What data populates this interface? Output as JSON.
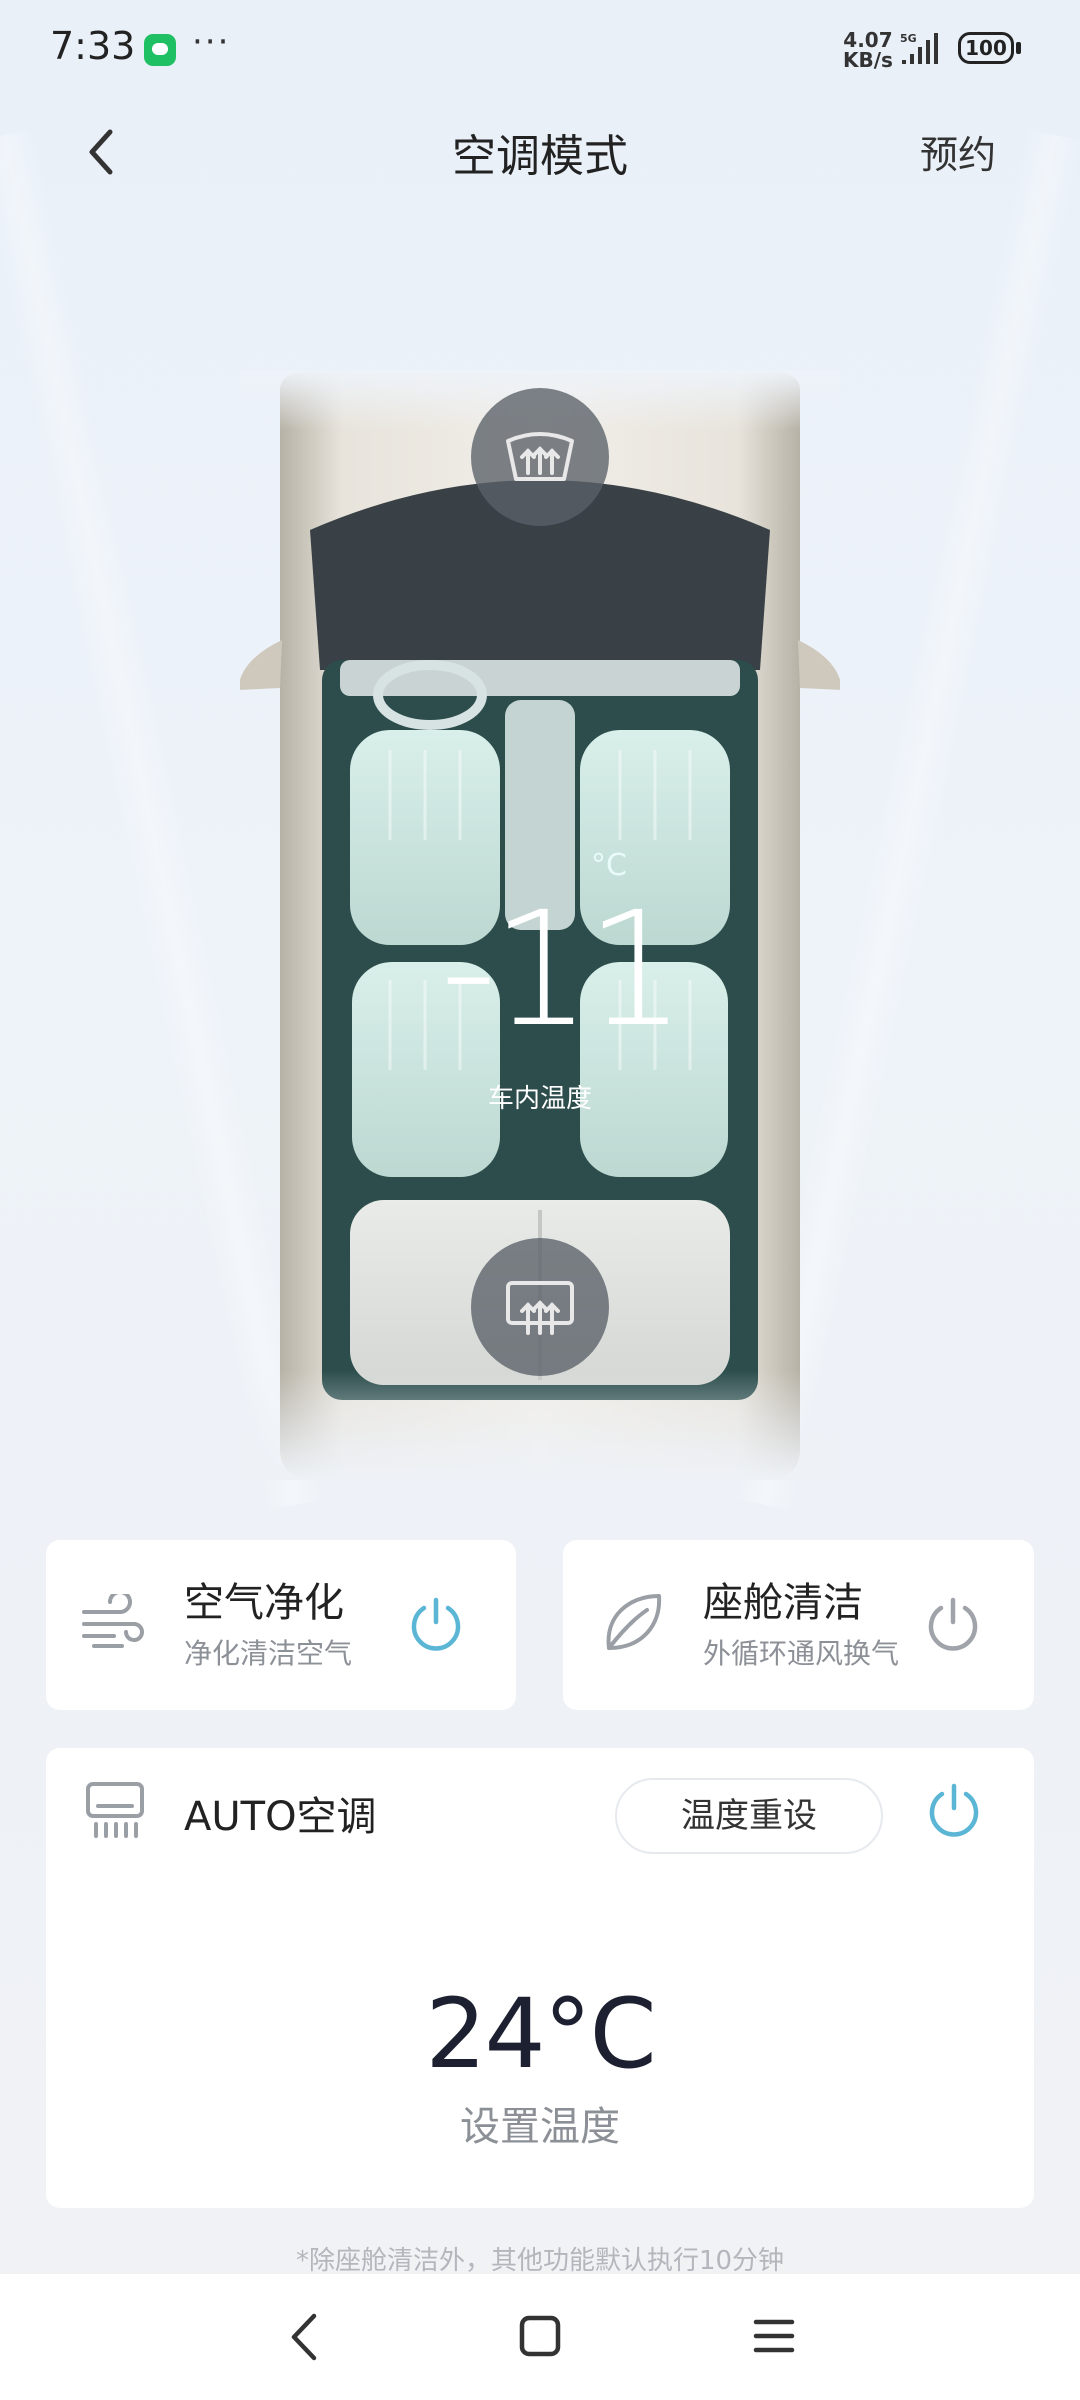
{
  "status_bar": {
    "time": "7:33",
    "dots": "···",
    "net_speed_value": "4.07",
    "net_speed_unit": "KB/s",
    "network_type": "5G",
    "battery": "100"
  },
  "header": {
    "title": "空调模式",
    "reserve_label": "预约"
  },
  "cabin": {
    "temperature": "-11",
    "unit": "°C",
    "label": "车内温度"
  },
  "cards": {
    "air_purify": {
      "title": "空气净化",
      "subtitle": "净化清洁空气",
      "icon": "wind-icon",
      "power_color": "#5bb6d6"
    },
    "cabin_clean": {
      "title": "座舱清洁",
      "subtitle": "外循环通风换气",
      "icon": "leaf-icon",
      "power_color": "#a0a4aa"
    },
    "auto_ac": {
      "title": "AUTO空调",
      "reset_label": "温度重设",
      "set_temperature": "24°C",
      "set_temperature_label": "设置温度",
      "icon": "air-conditioner-icon",
      "power_color": "#5bb6d6"
    }
  },
  "footnote": "*除座舱清洁外，其他功能默认执行10分钟",
  "colors": {
    "accent": "#5bb6d6",
    "interior": "#2c4d4c"
  }
}
